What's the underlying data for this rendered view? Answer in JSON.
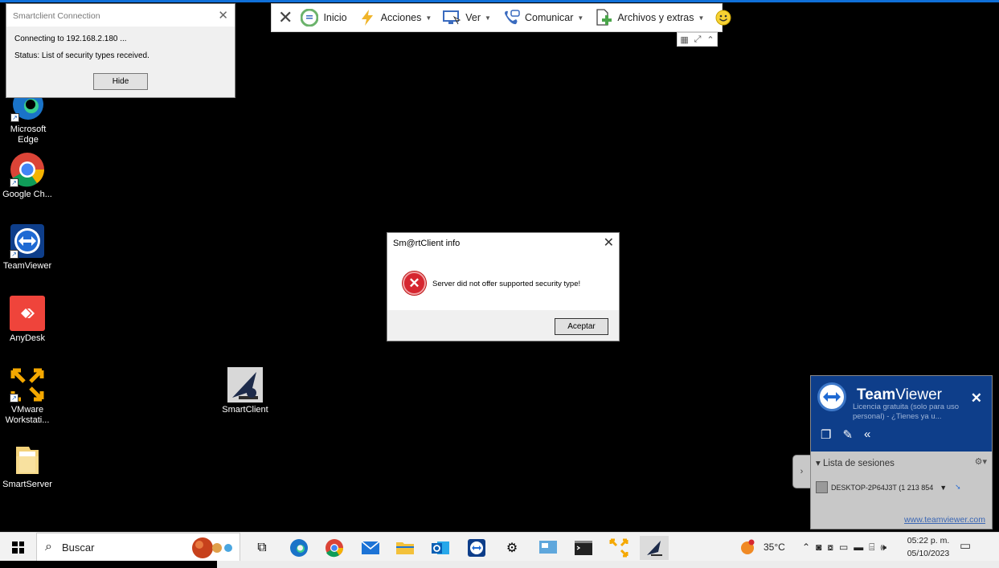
{
  "connection_window": {
    "title": "Smartclient Connection",
    "close": "✕",
    "line1": "Connecting to 192.168.2.180 ...",
    "line2": "Status: List of security types received.",
    "hide_label": "Hide"
  },
  "tv_toolbar": {
    "close": "✕",
    "items": [
      {
        "label": "Inicio",
        "icon": "home-icon"
      },
      {
        "label": "Acciones",
        "icon": "lightning-icon",
        "dropdown": true
      },
      {
        "label": "Ver",
        "icon": "monitor-icon",
        "dropdown": true
      },
      {
        "label": "Comunicar",
        "icon": "chat-icon",
        "dropdown": true
      },
      {
        "label": "Archivos y extras",
        "icon": "file-transfer-icon",
        "dropdown": true
      }
    ],
    "feedback_icon": "smiley-icon"
  },
  "desktop_icons": [
    {
      "label": "Microsoft Edge",
      "icon": "edge-icon"
    },
    {
      "label": "Google Ch...",
      "icon": "chrome-icon"
    },
    {
      "label": "TeamViewer",
      "icon": "teamviewer-icon"
    },
    {
      "label": "AnyDesk",
      "icon": "anydesk-icon"
    },
    {
      "label": "VMware Workstati...",
      "icon": "vmware-icon"
    },
    {
      "label": "SmartServer",
      "icon": "folder-icon"
    },
    {
      "label": "SmartClient",
      "icon": "smartclient-icon"
    }
  ],
  "info_dialog": {
    "title": "Sm@rtClient info",
    "close": "✕",
    "message": "Server did not offer supported security type!",
    "ok_label": "Aceptar"
  },
  "tv_panel": {
    "brand_bold": "Team",
    "brand_light": "Viewer",
    "license": "Licencia gratuita (solo para uso personal) - ¿Tienes ya u...",
    "close": "✕",
    "sessions_label": "Lista de sesiones",
    "host": "DESKTOP-2P64J3T (1 213 854",
    "link": "www.teamviewer.com",
    "expand": "›"
  },
  "taskbar": {
    "search_placeholder": "Buscar",
    "weather": "35°C",
    "time": "05:22 p. m.",
    "date": "05/10/2023"
  },
  "colors": {
    "accent": "#0f6fd8",
    "tv_blue": "#0e3e8a",
    "error_red": "#d62630",
    "taskbar": "#f2f2f2"
  }
}
